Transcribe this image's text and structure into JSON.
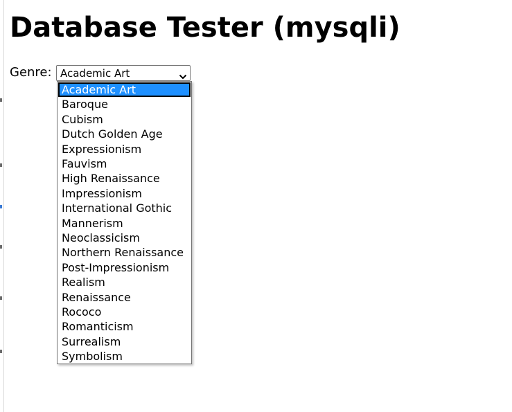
{
  "page": {
    "title": "Database Tester (mysqli)"
  },
  "form": {
    "genre_label": "Genre:",
    "genre_select": {
      "selected": "Academic Art",
      "options": [
        "Academic Art",
        "Baroque",
        "Cubism",
        "Dutch Golden Age",
        "Expressionism",
        "Fauvism",
        "High Renaissance",
        "Impressionism",
        "International Gothic",
        "Mannerism",
        "Neoclassicism",
        "Northern Renaissance",
        "Post-Impressionism",
        "Realism",
        "Renaissance",
        "Rococo",
        "Romanticism",
        "Surrealism",
        "Symbolism"
      ],
      "highlight_color": "#1e90ff"
    }
  }
}
